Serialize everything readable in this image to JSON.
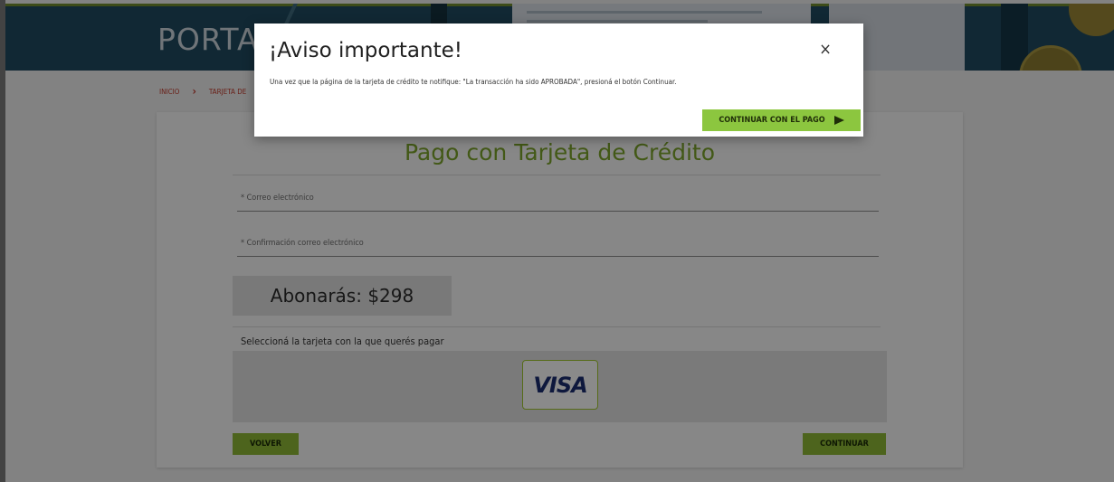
{
  "header": {
    "title": "PORTAL"
  },
  "breadcrumb": {
    "home": "INICIO",
    "separator": "›",
    "current": "TARJETA DE"
  },
  "form": {
    "title": "Pago con Tarjeta de Crédito",
    "email_label": "* Correo electrónico",
    "email_confirm_label": "* Confirmación correo electrónico",
    "amount_text": "Abonarás: $298",
    "select_card_label": "Seleccioná la tarjeta con la que querés pagar",
    "card_option": "VISA",
    "back_button": "VOLVER",
    "continue_button": "CONTINUAR"
  },
  "modal": {
    "title": "¡Aviso importante!",
    "close_glyph": "×",
    "body": "Una vez que la página de la tarjeta de crédito te notifique: \"La transacción ha sido APROBADA\", presioná el botón Continuar.",
    "continue_button": "CONTINUAR CON EL PAGO"
  },
  "colors": {
    "accent_green": "#8cc63f",
    "title_green": "#7aa32a",
    "banner": "#1f4a5f",
    "breadcrumb_red": "#c0392b"
  },
  "icons": {
    "close": "close-icon",
    "send": "send-arrow-icon",
    "breadcrumb_separator": "chevron-right-icon"
  }
}
